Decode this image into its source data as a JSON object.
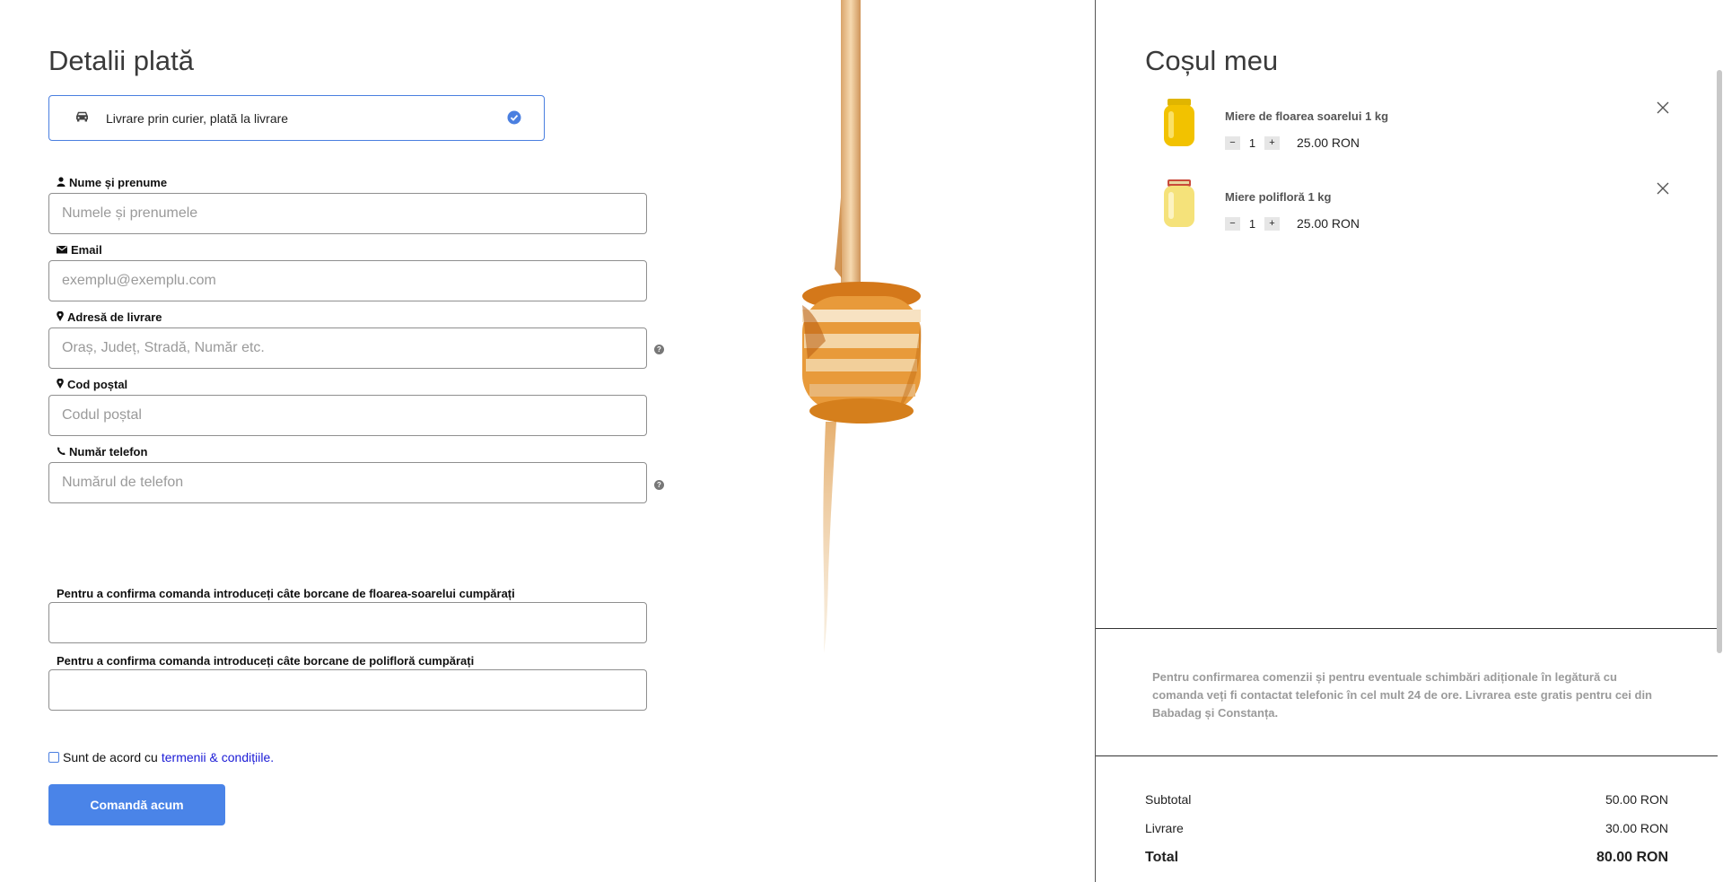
{
  "checkout": {
    "title": "Detalii plată",
    "delivery_option": {
      "label": "Livrare prin curier, plată la livrare",
      "selected": true
    },
    "fields": {
      "name": {
        "label": "Nume și prenume",
        "placeholder": "Numele și prenumele"
      },
      "email": {
        "label": "Email",
        "placeholder": "exemplu@exemplu.com"
      },
      "address": {
        "label": "Adresă de livrare",
        "placeholder": "Oraș, Județ, Stradă, Număr etc."
      },
      "postal": {
        "label": "Cod poștal",
        "placeholder": "Codul poștal"
      },
      "phone": {
        "label": "Număr telefon",
        "placeholder": "Numărul de telefon"
      }
    },
    "confirm": {
      "sunflower_label": "Pentru a confirma comanda introduceți câte borcane de floarea-soarelui cumpărați",
      "polyflora_label": "Pentru a confirma comanda introduceți câte borcane de polifloră cumpărați"
    },
    "terms": {
      "prefix": "Sunt de acord cu",
      "link": "termenii & condițiile.",
      "checked": false
    },
    "submit_label": "Comandă acum"
  },
  "cart": {
    "title": "Coșul meu",
    "items": [
      {
        "name": "Miere de floarea soarelui 1 kg",
        "qty": "1",
        "price": "25.00 RON",
        "jar_color": "#f2c200"
      },
      {
        "name": "Miere polifloră 1 kg",
        "qty": "1",
        "price": "25.00 RON",
        "jar_color": "#f5e27a"
      }
    ],
    "note": "Pentru confirmarea comenzii și pentru eventuale schimbări adiționale în legătură cu comanda veți fi contactat telefonic în cel mult 24 de ore. Livrarea este gratis pentru cei din Babadag și Constanța.",
    "summary": {
      "subtotal_label": "Subtotal",
      "subtotal": "50.00 RON",
      "shipping_label": "Livrare",
      "shipping": "30.00 RON",
      "total_label": "Total",
      "total": "80.00 RON"
    }
  },
  "colors": {
    "accent": "#4a84e8",
    "link": "#1a1ad6",
    "honey": "#e08a1e"
  }
}
